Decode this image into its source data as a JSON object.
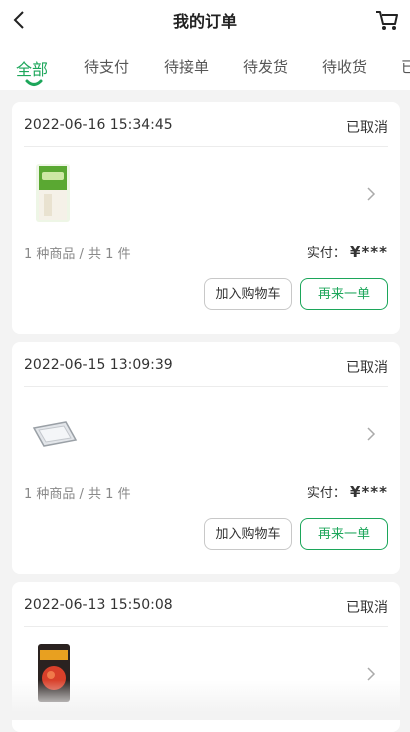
{
  "header": {
    "title": "我的订单",
    "back_icon": "back-arrow-icon",
    "cart_icon": "cart-icon"
  },
  "tabs": [
    {
      "label": "全部",
      "active": true
    },
    {
      "label": "待支付"
    },
    {
      "label": "待接单"
    },
    {
      "label": "待发货"
    },
    {
      "label": "待收货"
    },
    {
      "label": "已"
    }
  ],
  "orders": [
    {
      "date": "2022-06-16 15:34:45",
      "status": "已取消",
      "count": "1 种商品 / 共 1 件",
      "paid_label": "实付：",
      "amount": "¥***",
      "add_cart_label": "加入购物车",
      "reorder_label": "再来一单"
    },
    {
      "date": "2022-06-15 13:09:39",
      "status": "已取消",
      "count": "1 种商品 / 共 1 件",
      "paid_label": "实付：",
      "amount": "¥***",
      "add_cart_label": "加入购物车",
      "reorder_label": "再来一单"
    },
    {
      "date": "2022-06-13 15:50:08",
      "status": "已取消"
    }
  ],
  "colors": {
    "accent": "#1ca65a",
    "background": "#f3f3f3"
  }
}
